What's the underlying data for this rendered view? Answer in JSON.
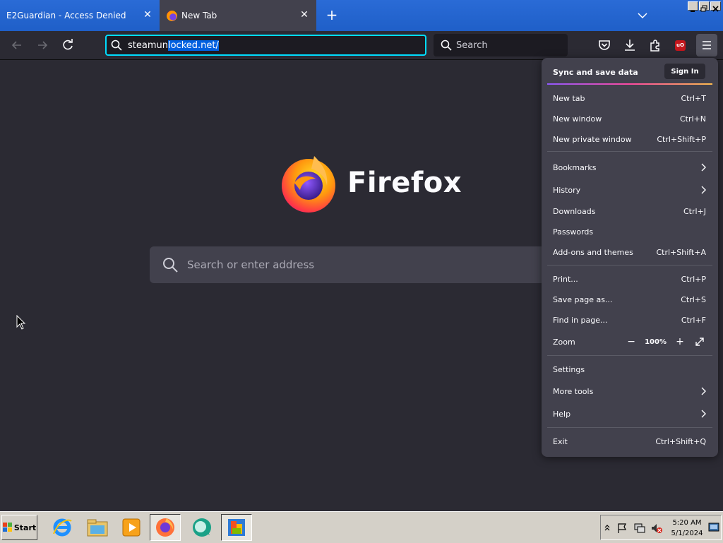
{
  "tabs": [
    {
      "title": "E2Guardian - Access Denied"
    },
    {
      "title": "New Tab"
    }
  ],
  "urlbar": {
    "value_prefix": "steamun",
    "value_selected": "locked.net/"
  },
  "searchbar": {
    "placeholder": "Search"
  },
  "brand": {
    "name": "Firefox"
  },
  "newtab_search": {
    "placeholder": "Search or enter address"
  },
  "ublock_badge": "uO",
  "menu": {
    "sync_label": "Sync and save data",
    "signin_label": "Sign In",
    "items": [
      {
        "label": "New tab",
        "shortcut": "Ctrl+T"
      },
      {
        "label": "New window",
        "shortcut": "Ctrl+N"
      },
      {
        "label": "New private window",
        "shortcut": "Ctrl+Shift+P"
      },
      {
        "label": "Bookmarks",
        "shortcut": ""
      },
      {
        "label": "History",
        "shortcut": ""
      },
      {
        "label": "Downloads",
        "shortcut": "Ctrl+J"
      },
      {
        "label": "Passwords",
        "shortcut": ""
      },
      {
        "label": "Add-ons and themes",
        "shortcut": "Ctrl+Shift+A"
      },
      {
        "label": "Print...",
        "shortcut": "Ctrl+P"
      },
      {
        "label": "Save page as...",
        "shortcut": "Ctrl+S"
      },
      {
        "label": "Find in page...",
        "shortcut": "Ctrl+F"
      },
      {
        "label": "Zoom",
        "shortcut": ""
      },
      {
        "label": "Settings",
        "shortcut": ""
      },
      {
        "label": "More tools",
        "shortcut": ""
      },
      {
        "label": "Help",
        "shortcut": ""
      },
      {
        "label": "Exit",
        "shortcut": "Ctrl+Shift+Q"
      }
    ],
    "zoom_level": "100%"
  },
  "taskbar": {
    "start_label": "Start",
    "clock_time": "5:20 AM",
    "clock_date": "5/1/2024"
  },
  "colors": {
    "accent_focus": "#00ddff",
    "menu_bg": "#42414d",
    "page_bg": "#2b2a33"
  },
  "icons": [
    "back-arrow-icon",
    "forward-arrow-icon",
    "reload-icon",
    "search-icon",
    "pocket-icon",
    "download-icon",
    "extensions-icon",
    "ublock-icon",
    "hamburger-menu-icon",
    "chevron-right-icon",
    "zoom-out-icon",
    "zoom-in-icon",
    "fullscreen-icon",
    "ie-icon",
    "explorer-icon",
    "media-player-icon",
    "firefox-icon",
    "chat-icon",
    "office-icon"
  ]
}
